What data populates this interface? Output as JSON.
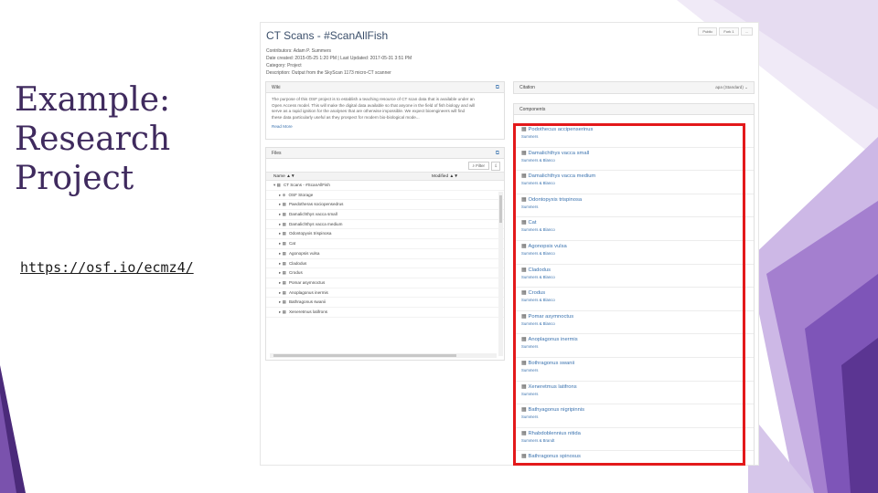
{
  "slide": {
    "title_lines": [
      "Example:",
      "Research",
      "Project"
    ],
    "link": "https://osf.io/ecmz4/"
  },
  "project": {
    "title": "CT Scans - #ScanAllFish",
    "contributors": "Contributors: Adam P. Summers",
    "dates": "Date created: 2015-05-25 1:20 PM | Last Updated: 2017-05-31 3:51 PM",
    "category": "Category: Project",
    "description": "Description: Output from the SkyScan 1173 micro-CT scanner",
    "top_buttons": [
      "Public",
      "Fork 1",
      "..."
    ]
  },
  "wiki": {
    "header": "Wiki",
    "lines": [
      "The purpose of this OSF project is to establish a teaching resource of CT scan data that is available under an",
      "Open Access model. This will make the digital data available so that anyone in the field of fish biology and will",
      "serve as a rapid ignition for the analyses that are otherwise impossible. We expect bioengineers will find",
      "these data particularly useful as they prospect for modern bio-biological mode..."
    ],
    "read_more": "Read More"
  },
  "files": {
    "header": "Files",
    "filter": "Filter",
    "download": "⇩",
    "col_name": "Name ▲▼",
    "col_modified": "Modified ▲▼",
    "rows": [
      {
        "glyph": "▾ ▦",
        "name": "CT Scans - #ScanAllFish",
        "indent": 8
      },
      {
        "glyph": "▸ ⊕",
        "name": "OSF Storage",
        "indent": 14
      },
      {
        "glyph": "▸ ▦",
        "name": "Paedotheras sociopensedrus",
        "indent": 14
      },
      {
        "glyph": "▸ ▦",
        "name": "Damalichthys vacca small",
        "indent": 14
      },
      {
        "glyph": "▸ ▦",
        "name": "Damalichthys vacca medium",
        "indent": 14
      },
      {
        "glyph": "▸ ▦",
        "name": "Odontopyxis trispinosa",
        "indent": 14
      },
      {
        "glyph": "▸ ▦",
        "name": "Cat",
        "indent": 14
      },
      {
        "glyph": "▸ ▦",
        "name": "Agonopsis vulsa",
        "indent": 14
      },
      {
        "glyph": "▸ ▦",
        "name": "Cladodus",
        "indent": 14
      },
      {
        "glyph": "▸ ▦",
        "name": "Crodus",
        "indent": 14
      },
      {
        "glyph": "▸ ▦",
        "name": "Pomar asymnoctus",
        "indent": 14
      },
      {
        "glyph": "▸ ▦",
        "name": "Anoplagonus inermis",
        "indent": 14
      },
      {
        "glyph": "▸ ▦",
        "name": "Bathragonus swanii",
        "indent": 14
      },
      {
        "glyph": "▸ ▦",
        "name": "Xeneretmus latifrons",
        "indent": 14
      }
    ]
  },
  "citation": {
    "header": "Citation",
    "selector": "apa (Standard) ⌄"
  },
  "components": {
    "header": "Components",
    "items": [
      {
        "name": "Podothecus accipenserinus",
        "sub": "Summers"
      },
      {
        "name": "Damalichthys vacca small",
        "sub": "Summers & Blanco"
      },
      {
        "name": "Damalichthys vacca medium",
        "sub": "Summers & Blanco"
      },
      {
        "name": "Odontopyxis trispinosa",
        "sub": "Summers"
      },
      {
        "name": "Cat",
        "sub": "Summers & Blanco"
      },
      {
        "name": "Agonopsis vulsa",
        "sub": "Summers & Blanco"
      },
      {
        "name": "Cladodus",
        "sub": "Summers & Blanco"
      },
      {
        "name": "Crodus",
        "sub": "Summers & Blanco"
      },
      {
        "name": "Pomar asymnoctus",
        "sub": "Summers & Blanco"
      },
      {
        "name": "Anoplagonus inermis",
        "sub": "Summers"
      },
      {
        "name": "Bothragonus swanii",
        "sub": "Summers"
      },
      {
        "name": "Xeneretmus latifrons",
        "sub": "Summers"
      },
      {
        "name": "Bathyagonus nigripinnis",
        "sub": "Summers"
      },
      {
        "name": "Rhabdoblennius nitida",
        "sub": "Summers & Brandt"
      },
      {
        "name": "Bathragonus spinosus",
        "sub": ""
      }
    ]
  },
  "colors": {
    "title": "#3f2a5e",
    "purple_dark": "#4b2a7a",
    "purple_light": "#a47fcf",
    "highlight": "#e3191b",
    "link_blue": "#3b73af"
  }
}
